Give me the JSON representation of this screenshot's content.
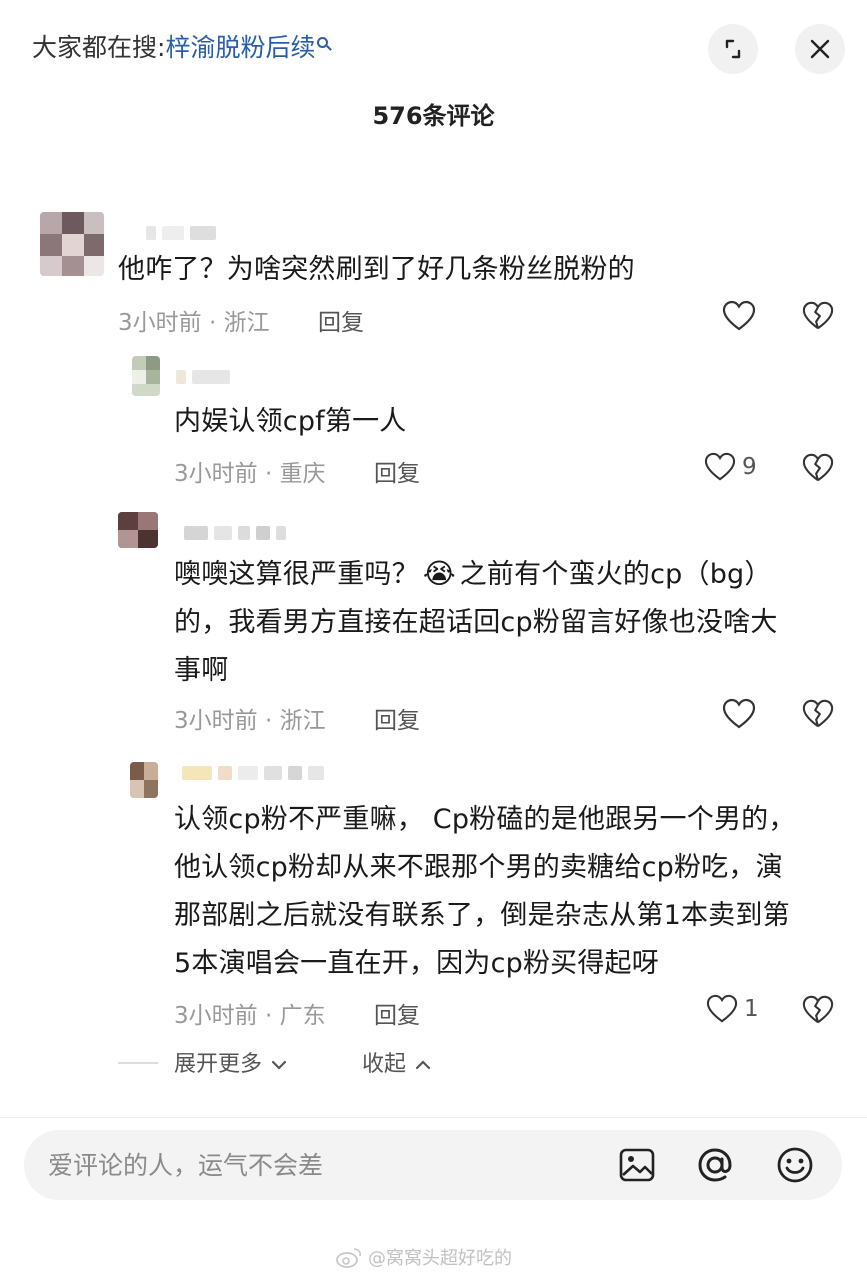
{
  "header": {
    "hot_search_label": "大家都在搜:",
    "hot_search_keyword": "梓渝脱粉后续",
    "comment_count": "576条评论"
  },
  "comments": [
    {
      "text": "他咋了？为啥突然刷到了好几条粉丝脱粉的",
      "meta": "3小时前 · 浙江",
      "reply": "回复",
      "likes": ""
    },
    {
      "text": "内娱认领cpf第一人",
      "meta": "3小时前 · 重庆",
      "reply": "回复",
      "likes": "9"
    },
    {
      "text_lines": [
        "噢噢这算很严重吗？",
        "之前有个蛮火的cp（bg）",
        "的，我看男方直接在超话回cp粉留言好像也没啥大",
        "事啊"
      ],
      "emoji": "😭",
      "meta": "3小时前 · 浙江",
      "reply": "回复",
      "likes": ""
    },
    {
      "text_lines": [
        "认领cp粉不严重嘛， Cp粉磕的是他跟另一个男的，",
        "他认领cp粉却从来不跟那个男的卖糖给cp粉吃，演",
        "那部剧之后就没有联系了，倒是杂志从第1本卖到第",
        "5本演唱会一直在开，因为cp粉买得起呀"
      ],
      "meta": "3小时前 · 广东",
      "reply": "回复",
      "likes": "1"
    }
  ],
  "thread_controls": {
    "expand_more": "展开更多",
    "collapse": "收起"
  },
  "input": {
    "placeholder": "爱评论的人，运气不会差"
  },
  "watermark": "@窝窝头超好吃的",
  "icons": {
    "collapse": "collapse-icon",
    "close": "close-icon",
    "like": "heart-icon",
    "dislike": "broken-heart-icon",
    "image": "image-icon",
    "mention": "at-icon",
    "emoji": "emoji-icon"
  }
}
